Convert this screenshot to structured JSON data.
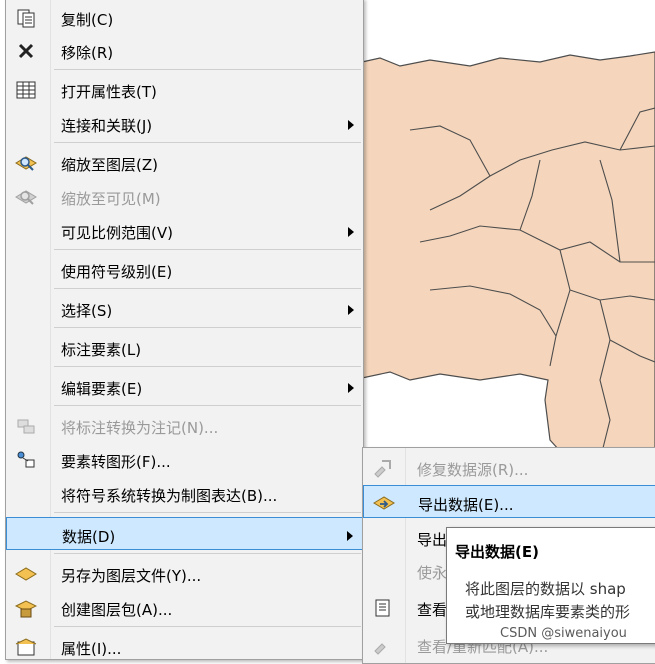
{
  "main_menu": {
    "items": [
      {
        "label": "复制(C)",
        "icon": "copy-icon"
      },
      {
        "label": "移除(R)",
        "icon": "remove-x-icon"
      },
      {
        "label": "打开属性表(T)",
        "icon": "attribute-table-icon"
      },
      {
        "label": "连接和关联(J)"
      },
      {
        "label": "缩放至图层(Z)",
        "icon": "zoom-to-layer-icon"
      },
      {
        "label": "缩放至可见(M)",
        "icon": "zoom-to-visible-icon",
        "disabled": true
      },
      {
        "label": "可见比例范围(V)"
      },
      {
        "label": "使用符号级别(E)"
      },
      {
        "label": "选择(S)"
      },
      {
        "label": "标注要素(L)"
      },
      {
        "label": "编辑要素(E)"
      },
      {
        "label": "将标注转换为注记(N)...",
        "icon": "convert-labels-icon",
        "disabled": true
      },
      {
        "label": "要素转图形(F)...",
        "icon": "features-to-graphics-icon"
      },
      {
        "label": "将符号系统转换为制图表达(B)..."
      },
      {
        "label": "数据(D)",
        "highlighted": true
      },
      {
        "label": "另存为图层文件(Y)...",
        "icon": "save-layer-file-icon"
      },
      {
        "label": "创建图层包(A)...",
        "icon": "create-layer-package-icon"
      },
      {
        "label": "属性(I)...",
        "icon": "properties-icon"
      }
    ]
  },
  "sub_menu": {
    "items": [
      {
        "label": "修复数据源(R)...",
        "icon": "repair-data-source-icon",
        "disabled": true
      },
      {
        "label": "导出数据(E)...",
        "icon": "export-data-icon",
        "highlighted": true
      },
      {
        "label": "导出"
      },
      {
        "label": "使永",
        "disabled": true
      },
      {
        "label": "查看",
        "icon": "view-metadata-icon"
      },
      {
        "label": "查看/重新匹配(A)...",
        "icon": "rematch-icon",
        "disabled": true
      }
    ]
  },
  "tooltip": {
    "title": "导出数据(E)",
    "line1": "将此图层的数据以 shap",
    "line2": "或地理数据库要素类的形"
  },
  "watermark": "CSDN @siwenaiyou",
  "colors": {
    "map_fill": "#f5d6bc",
    "highlight": "#cde8ff",
    "highlight_border": "#3a8ed6"
  }
}
